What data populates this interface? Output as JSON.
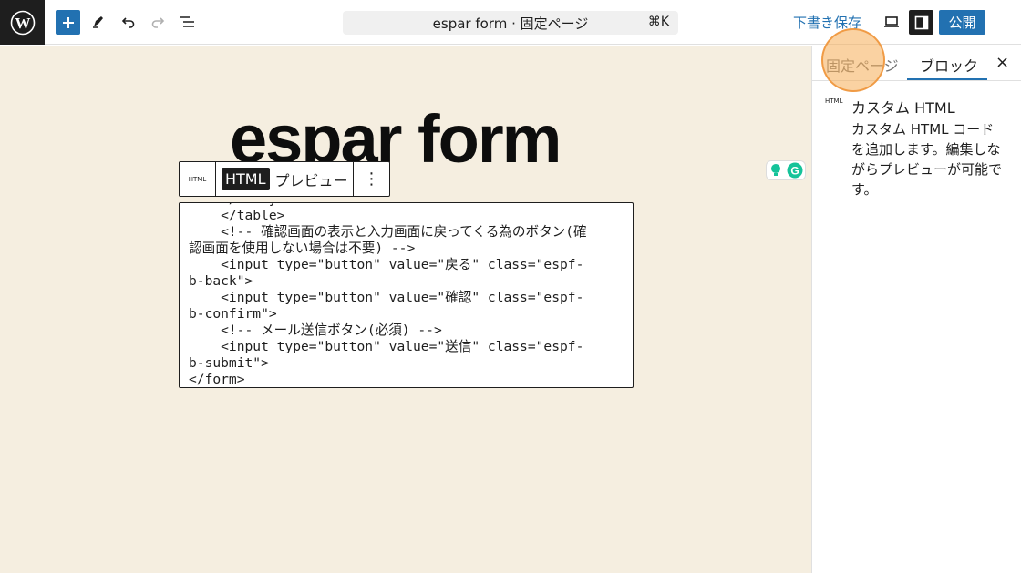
{
  "toolbar": {
    "document_title": "espar form · 固定ページ",
    "shortcut": "⌘K",
    "save_draft": "下書き保存",
    "publish": "公開"
  },
  "canvas": {
    "page_title": "espar form",
    "block_toolbar": {
      "type_label": "HTML",
      "html_tab": "HTML",
      "preview_tab": "プレビュー",
      "more": "⋮"
    },
    "code_lines": [
      "    </table>",
      "    <!-- 確認画面の表示と入力画面に戻ってくる為のボタン(確",
      "認画面を使用しない場合は不要) -->",
      "    <input type=\"button\" value=\"戻る\" class=\"espf-",
      "b-back\">",
      "    <input type=\"button\" value=\"確認\" class=\"espf-",
      "b-confirm\">",
      "    <!-- メール送信ボタン(必須) -->",
      "    <input type=\"button\" value=\"送信\" class=\"espf-",
      "b-submit\">",
      "</form>"
    ]
  },
  "sidebar": {
    "tab_page": "固定ページ",
    "tab_block": "ブロック",
    "close": "×",
    "block_icon_label": "HTML",
    "block_title": "カスタム HTML",
    "block_description": "カスタム HTML コードを追加します。編集しながらプレビューが可能です。"
  },
  "colors": {
    "accent": "#2271b1",
    "canvas_bg": "#f5eee0",
    "highlight": "#f6ad55"
  }
}
